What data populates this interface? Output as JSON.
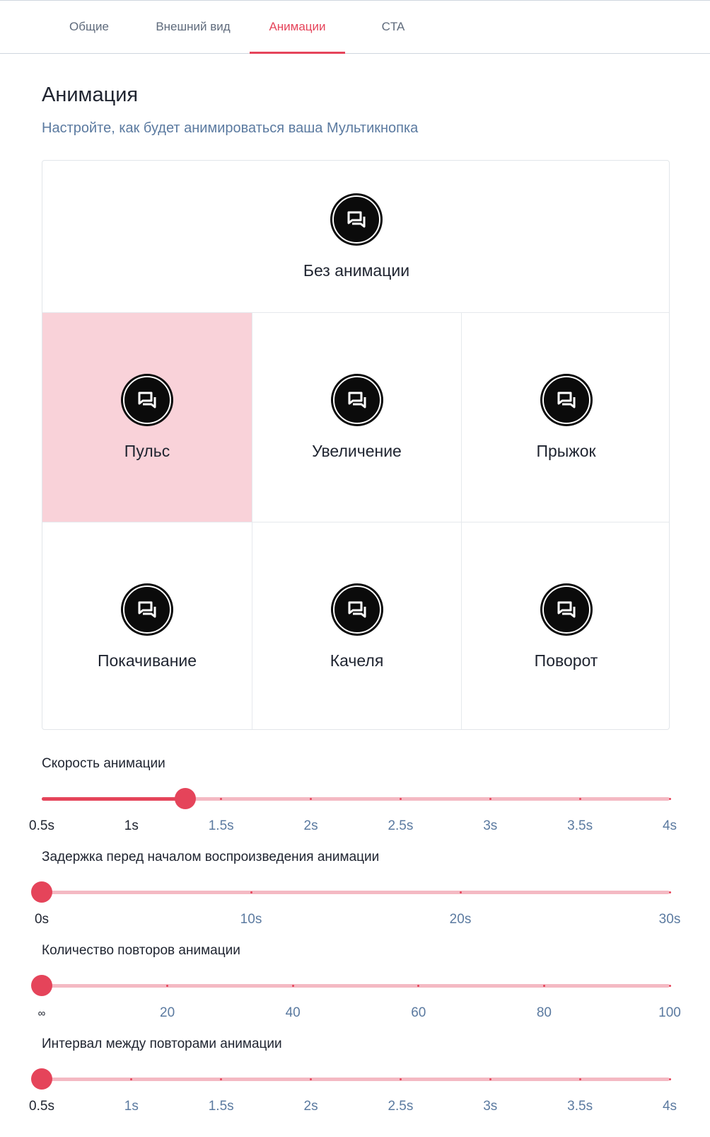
{
  "tabs": {
    "items": [
      {
        "label": "Общие"
      },
      {
        "label": "Внешний вид"
      },
      {
        "label": "Анимации"
      },
      {
        "label": "CTA"
      }
    ],
    "active_index": 2
  },
  "section": {
    "title": "Анимация",
    "subtitle": "Настройте, как будет анимироваться ваша Мультикнопка"
  },
  "animations": {
    "selected": "Пульс",
    "icon": "chat-bubbles-icon",
    "options": [
      {
        "label": "Без анимации"
      },
      {
        "label": "Пульс"
      },
      {
        "label": "Увеличение"
      },
      {
        "label": "Прыжок"
      },
      {
        "label": "Покачивание"
      },
      {
        "label": "Качеля"
      },
      {
        "label": "Поворот"
      }
    ]
  },
  "sliders": {
    "speed": {
      "label": "Скорость анимации",
      "ticks": [
        "0.5s",
        "1s",
        "1.5s",
        "2s",
        "2.5s",
        "3s",
        "3.5s",
        "4s"
      ],
      "value": 1.3
    },
    "delay": {
      "label": "Задержка перед началом воспроизведения анимации",
      "ticks": [
        "0s",
        "10s",
        "20s",
        "30s"
      ],
      "value": 0
    },
    "repeats": {
      "label": "Количество повторов анимации",
      "ticks": [
        "∞",
        "20",
        "40",
        "60",
        "80",
        "100"
      ],
      "value": "∞"
    },
    "interval": {
      "label": "Интервал между повторами анимации",
      "ticks": [
        "0.5s",
        "1s",
        "1.5s",
        "2s",
        "2.5s",
        "3s",
        "3.5s",
        "4s"
      ],
      "value": 0.5
    }
  },
  "colors": {
    "accent": "#e5445a",
    "track": "#f4b9c3",
    "selected_cell": "#f9d2d9",
    "muted_text": "#5b7aa0"
  }
}
